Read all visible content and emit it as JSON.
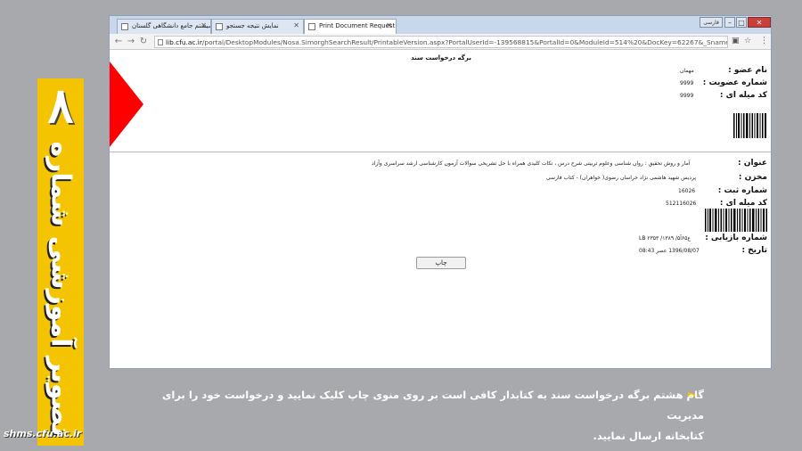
{
  "banner": {
    "number": "۸",
    "title": "تصویر آموزشی شماره",
    "site": "shms.cfu.ac.ir",
    "color": "#f5c400"
  },
  "browser": {
    "tabs": [
      {
        "label": "سیستم جامع دانشگاهی گلستان",
        "icon": "page-icon"
      },
      {
        "label": "نمایش نتیجه جستجو",
        "icon": "page-icon"
      },
      {
        "label": "Print Document Request",
        "icon": "page-icon",
        "active": true
      }
    ],
    "lang_button": "فارسی",
    "url_domain": "lib.cfu.ac.ir",
    "url_path": "/portal/DesktopModules/Nosa.SimorghSearchResult/PrintableVersion.aspx?PortalUserId=-139568815&PortalId=0&ModuleId=514%20&DocKey=62267&_Sname=FARHANGI..."
  },
  "document": {
    "title": "برگه درخواست سند",
    "member": [
      {
        "label": "نام عضو :",
        "value": "مهمان"
      },
      {
        "label": "شماره عضویت :",
        "value": "9999"
      },
      {
        "label": "کد میله ای :",
        "value": "9999"
      }
    ],
    "book": [
      {
        "label": "عنوان :",
        "value": "آمار و روش تحقیق : روان شناسی وعلوم تربیتی شرح درس ، نکات کلیدی همراه با حل تشریحی سوالات آزمون کارشناسی ارشد سراسری وآزاد"
      },
      {
        "label": "مخزن :",
        "value": "پردیس شهید هاشمی نژاد خراسان رضوی( خواهران) - کتاب فارسی"
      },
      {
        "label": "شماره ثبت :",
        "value": "16026"
      },
      {
        "label": "کد میله ای :",
        "value": "512116026"
      },
      {
        "label": "شماره بازیابی :",
        "value": "LB ۲۳۵۳ /ع۶۵آ۵/ ۱۳۸۹"
      },
      {
        "label": "تاریخ :",
        "value": "1396/08/07 عصر 08:43"
      }
    ],
    "print_button": "چاپ",
    "accent": "#ff0000"
  },
  "caption": {
    "line1": "گام هشتم برگه درخواست سند به کتابدار   کافی است بر روی منوی چاپ کلیک نمایید و درخواست خود را برای مدیریت",
    "line2": "کتابخانه ارسال نمایید."
  }
}
